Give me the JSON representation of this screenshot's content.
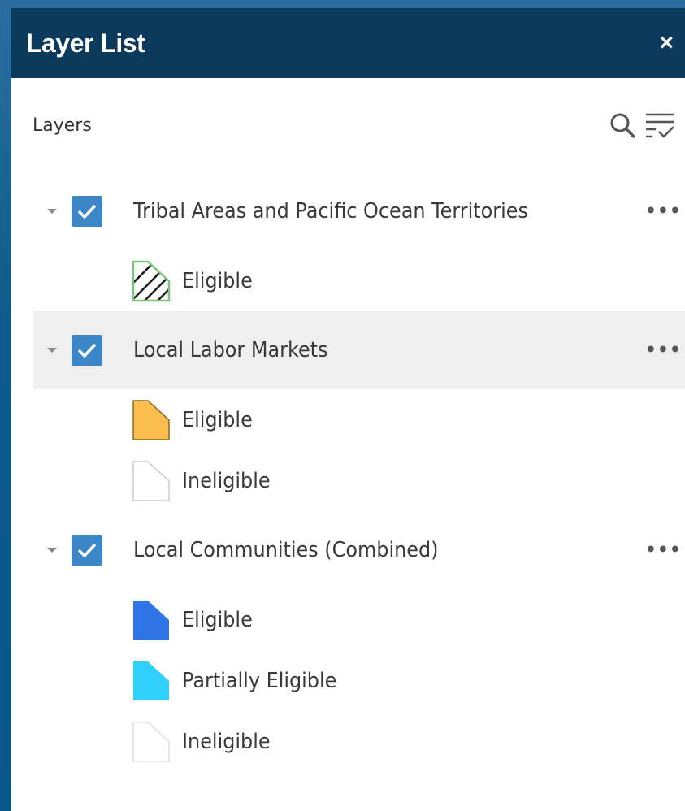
{
  "panel": {
    "title": "Layer List",
    "close_label": "×",
    "layers_label": "Layers"
  },
  "icons": {
    "search": "search-icon",
    "filter": "filter-list-icon",
    "caret": "caret-down-icon",
    "checkbox": "checkmark-icon",
    "more": "more-options-icon"
  },
  "colors": {
    "header_bg": "#0b3a5d",
    "checkbox": "#3b87c7",
    "highlight_row": "#efefef",
    "eligible_labor": "#fbbd4d",
    "eligible_community": "#2f75e6",
    "partial_community": "#2fd0fb",
    "tribal_outline": "#7ec87a"
  },
  "layers": [
    {
      "title": "Tribal Areas and Pacific Ocean Territories",
      "more": "•••",
      "legend": [
        {
          "label": "Eligible"
        }
      ]
    },
    {
      "title": "Local Labor Markets",
      "more": "•••",
      "legend": [
        {
          "label": "Eligible"
        },
        {
          "label": "Ineligible"
        }
      ]
    },
    {
      "title": "Local Communities (Combined)",
      "more": "•••",
      "legend": [
        {
          "label": "Eligible"
        },
        {
          "label": "Partially Eligible"
        },
        {
          "label": "Ineligible"
        }
      ]
    }
  ]
}
